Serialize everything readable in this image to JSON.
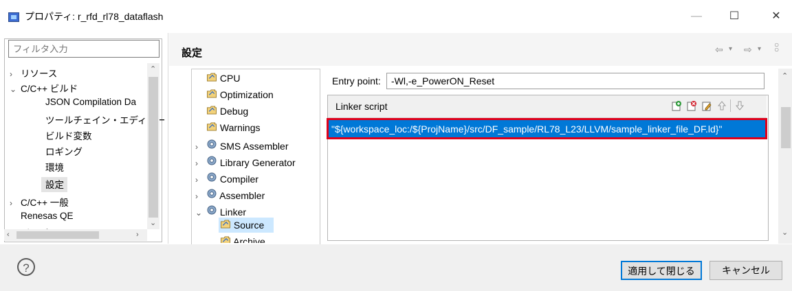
{
  "window": {
    "title": "プロパティ: r_rfd_rl78_dataflash",
    "minimize_label": "—",
    "maximize_label": "☐",
    "close_label": "✕"
  },
  "filter": {
    "placeholder": "フィルタ入力"
  },
  "left_tree": {
    "items": [
      {
        "label": "リソース",
        "twisty": "›"
      },
      {
        "label": "C/C++ ビルド",
        "twisty": "⌄"
      },
      {
        "label": "JSON Compilation Da",
        "twisty": ""
      },
      {
        "label": "ツールチェイン・エディター",
        "twisty": ""
      },
      {
        "label": "ビルド変数",
        "twisty": ""
      },
      {
        "label": "ロギング",
        "twisty": ""
      },
      {
        "label": "環境",
        "twisty": ""
      },
      {
        "label": "設定",
        "twisty": ""
      },
      {
        "label": "C/C++ 一般",
        "twisty": "›"
      },
      {
        "label": "Renesas QE",
        "twisty": ""
      },
      {
        "label": "ビルダー",
        "twisty": ""
      }
    ]
  },
  "header": {
    "title": "設定"
  },
  "tool_tree": {
    "items": [
      {
        "label": "CPU",
        "icon": "folder-icon",
        "twisty": ""
      },
      {
        "label": "Optimization",
        "icon": "folder-icon",
        "twisty": ""
      },
      {
        "label": "Debug",
        "icon": "folder-icon",
        "twisty": ""
      },
      {
        "label": "Warnings",
        "icon": "folder-icon",
        "twisty": ""
      },
      {
        "label": "SMS Assembler",
        "icon": "gear-icon",
        "twisty": "›"
      },
      {
        "label": "Library Generator",
        "icon": "gear-icon",
        "twisty": "›"
      },
      {
        "label": "Compiler",
        "icon": "gear-icon",
        "twisty": "›"
      },
      {
        "label": "Assembler",
        "icon": "gear-icon",
        "twisty": "›"
      },
      {
        "label": "Linker",
        "icon": "gear-icon",
        "twisty": "⌄"
      },
      {
        "label": "Source",
        "icon": "folder-icon",
        "twisty": ""
      },
      {
        "label": "Archive",
        "icon": "folder-icon",
        "twisty": ""
      }
    ]
  },
  "entry_point": {
    "label": "Entry point:",
    "value": "-Wl,-e_PowerON_Reset"
  },
  "linker_script": {
    "title": "Linker script",
    "value": "\"${workspace_loc:/${ProjName}/src/DF_sample/RL78_L23/LLVM/sample_linker_file_DF.ld}\""
  },
  "buttons": {
    "apply_close": "適用して閉じる",
    "cancel": "キャンセル"
  },
  "colors": {
    "selection": "#0078d7",
    "highlight_border": "#e0001a",
    "tree_selection": "#cce8ff"
  }
}
